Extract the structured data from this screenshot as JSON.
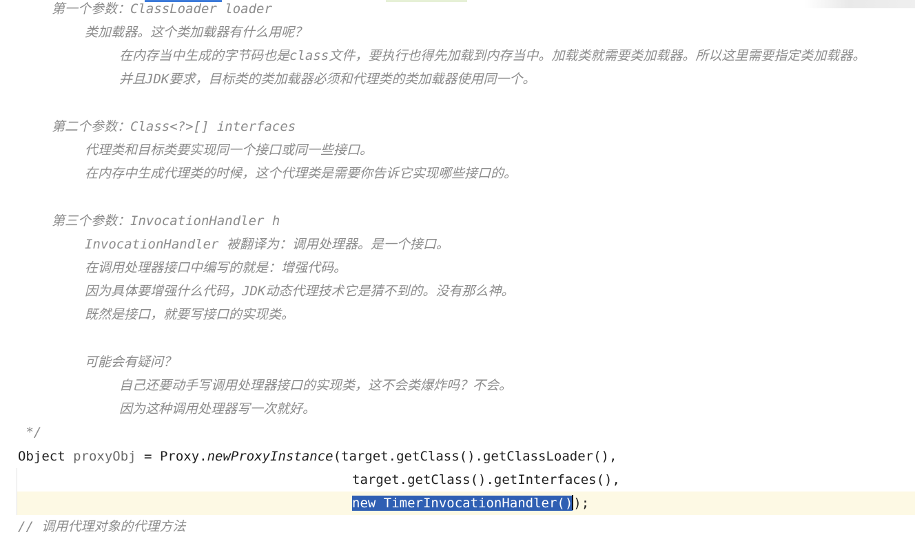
{
  "comment_block": {
    "p1_title_cn": "第一个参数：",
    "p1_title_code": "ClassLoader loader",
    "p1_line1": "类加载器。这个类加载器有什么用呢？",
    "p1_line2_a": "在内存当中生成的字节码也是",
    "p1_line2_code": "class",
    "p1_line2_b": "文件，要执行也得先加载到内存当中。加载类就需要类加载器。所以这里需要指定类加载器。",
    "p1_line3_a": "并且",
    "p1_line3_code": "JDK",
    "p1_line3_b": "要求，目标类的类加载器必须和代理类的类加载器使用同一个。",
    "p2_title_cn": "第二个参数：",
    "p2_title_code": "Class<?>[] interfaces",
    "p2_line1": "代理类和目标类要实现同一个接口或同一些接口。",
    "p2_line2": "在内存中生成代理类的时候，这个代理类是需要你告诉它实现哪些接口的。",
    "p3_title_cn": "第三个参数：",
    "p3_title_code": "InvocationHandler h",
    "p3_line1_code": "InvocationHandler",
    "p3_line1_b": " 被翻译为：调用处理器。是一个接口。",
    "p3_line2": "在调用处理器接口中编写的就是：增强代码。",
    "p3_line3_a": "因为具体要增强什么代码，",
    "p3_line3_code": "JDK",
    "p3_line3_b": "动态代理技术它是猜不到的。没有那么神。",
    "p3_line4": "既然是接口，就要写接口的实现类。",
    "q_title": "可能会有疑问？",
    "q_line1": "自己还要动手写调用处理器接口的实现类，这不会类爆炸吗？不会。",
    "q_line2": "因为这种调用处理器写一次就好。",
    "close": " */"
  },
  "code": {
    "l1_type": "Object",
    "l1_var": "proxyObj",
    "l1_eq": " = ",
    "l1_class": "Proxy.",
    "l1_method": "newProxyInstance",
    "l1_args": "(target.getClass().getClassLoader(),",
    "l2": "target.getClass().getInterfaces(),",
    "l3_selected": "new TimerInvocationHandler()",
    "l3_rest": ");",
    "l4_comment": "// 调用代理对象的代理方法"
  },
  "colors": {
    "comment": "#8c8c8c",
    "code": "#1f1f1f",
    "selection": "#2f5fb3",
    "current_line": "#fdf9e4"
  }
}
